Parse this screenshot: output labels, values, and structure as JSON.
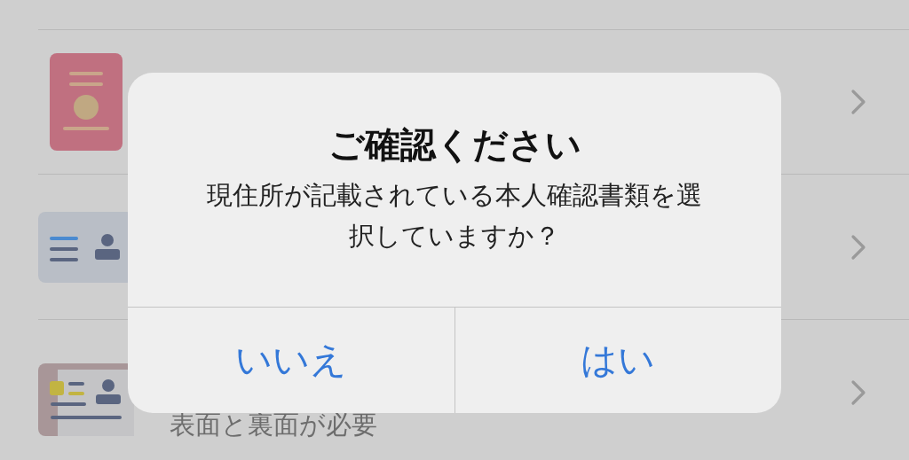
{
  "list": [
    {
      "kind": "passport"
    },
    {
      "kind": "card"
    },
    {
      "kind": "photo-card",
      "subtitle": "表面と裏面が必要"
    }
  ],
  "dialog": {
    "title": "ご確認ください",
    "message": "現住所が記載されている本人確認書類を選択していますか？",
    "buttons": [
      {
        "label": "いいえ"
      },
      {
        "label": "はい"
      }
    ]
  }
}
